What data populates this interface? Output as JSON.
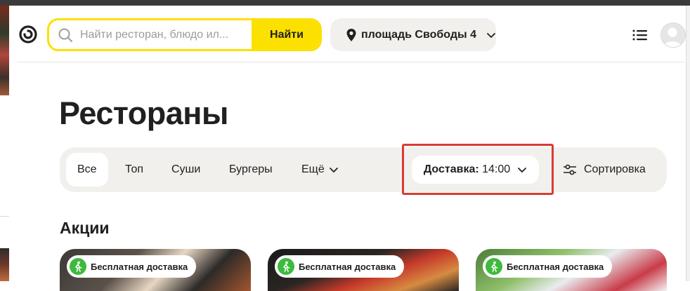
{
  "header": {
    "search": {
      "placeholder": "Найти ресторан, блюдо ил...",
      "button_label": "Найти"
    },
    "address": {
      "label": "площадь Свободы 4"
    }
  },
  "page": {
    "title": "Рестораны"
  },
  "filters": {
    "chips": [
      {
        "label": "Все",
        "active": true
      },
      {
        "label": "Топ",
        "active": false
      },
      {
        "label": "Суши",
        "active": false
      },
      {
        "label": "Бургеры",
        "active": false
      },
      {
        "label": "Ещё",
        "active": false
      }
    ],
    "delivery": {
      "prefix": "Доставка:",
      "time": "14:00"
    },
    "sort_label": "Сортировка"
  },
  "promos": {
    "title": "Акции",
    "cards": [
      {
        "badge": "Бесплатная доставка"
      },
      {
        "badge": "Бесплатная доставка"
      },
      {
        "badge": "Бесплатная доставка"
      }
    ]
  },
  "colors": {
    "accent_yellow": "#fce000",
    "highlight_red": "#d83b32",
    "chip_bg": "#f2f0ed",
    "badge_green": "#3dbb3d"
  }
}
